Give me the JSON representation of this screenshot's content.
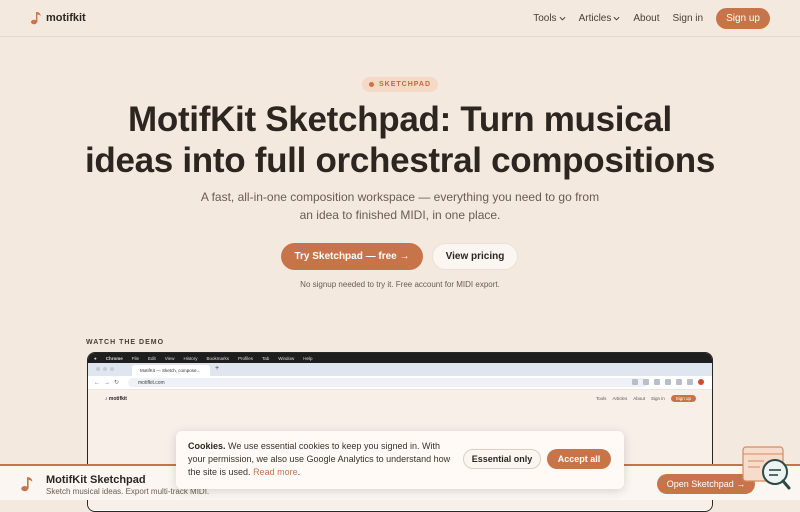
{
  "header": {
    "brand": "motifkit",
    "nav": {
      "tools": "Tools",
      "articles": "Articles",
      "about": "About",
      "login": "Sign in",
      "signup": "Sign up"
    }
  },
  "hero": {
    "badge": "SKETCHPAD",
    "title_line1": "MotifKit Sketchpad: Turn musical",
    "title_line2": "ideas into full orchestral compositions",
    "subtitle_line1": "A fast, all-in-one composition workspace — everything you need to go from",
    "subtitle_line2": "an idea to finished MIDI, in one place.",
    "primary_button": "Try Sketchpad — free →",
    "secondary_button": "View pricing",
    "note": "No signup needed to try it. Free account for MIDI export."
  },
  "demo": {
    "label": "WATCH THE DEMO",
    "menubar": [
      "Chrome",
      "File",
      "Edit",
      "View",
      "History",
      "Bookmarks",
      "Profiles",
      "Tab",
      "Window",
      "Help"
    ],
    "tab_title": "MotifKit — Sketch, compose...",
    "url": "motifkit.com",
    "inner_brand": "motifkit",
    "inner_nav": [
      "Tools",
      "Articles",
      "About",
      "Sign in",
      "Sign up"
    ]
  },
  "cookie": {
    "heading": "Cookies.",
    "text": "We use essential cookies to keep you signed in. With your permission, we also use Google Analytics to understand how the site is used.",
    "read_more": "Read more",
    "essential_button": "Essential only",
    "accept_button": "Accept all"
  },
  "bottom_bar": {
    "title": "MotifKit Sketchpad",
    "subtitle": "Sketch musical ideas. Export multi-track MIDI.",
    "button": "Open Sketchpad →"
  },
  "colors": {
    "accent": "#c8744b",
    "background": "#f3e9df",
    "text": "#2d2520"
  }
}
